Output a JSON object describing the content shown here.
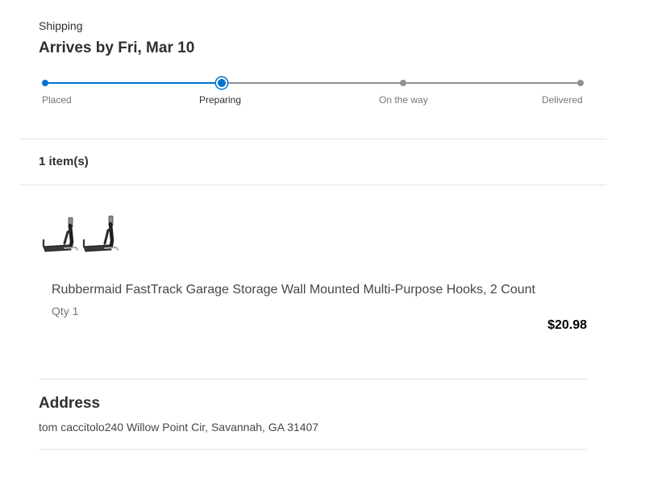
{
  "shipping": {
    "label": "Shipping",
    "arrival": "Arrives by Fri, Mar 10",
    "steps": [
      "Placed",
      "Preparing",
      "On the way",
      "Delivered"
    ],
    "current_step": "Preparing"
  },
  "items": {
    "count_label": "1 item(s)",
    "list": [
      {
        "name": "Rubbermaid FastTrack Garage Storage Wall Mounted Multi-Purpose Hooks, 2 Count",
        "qty": "Qty 1",
        "price": "$20.98"
      }
    ]
  },
  "address": {
    "title": "Address",
    "text": "tom caccitolo240 Willow Point Cir, Savannah, GA 31407"
  },
  "colors": {
    "accent": "#0071ce",
    "pending": "#909196",
    "divider": "#e3e4e5"
  }
}
